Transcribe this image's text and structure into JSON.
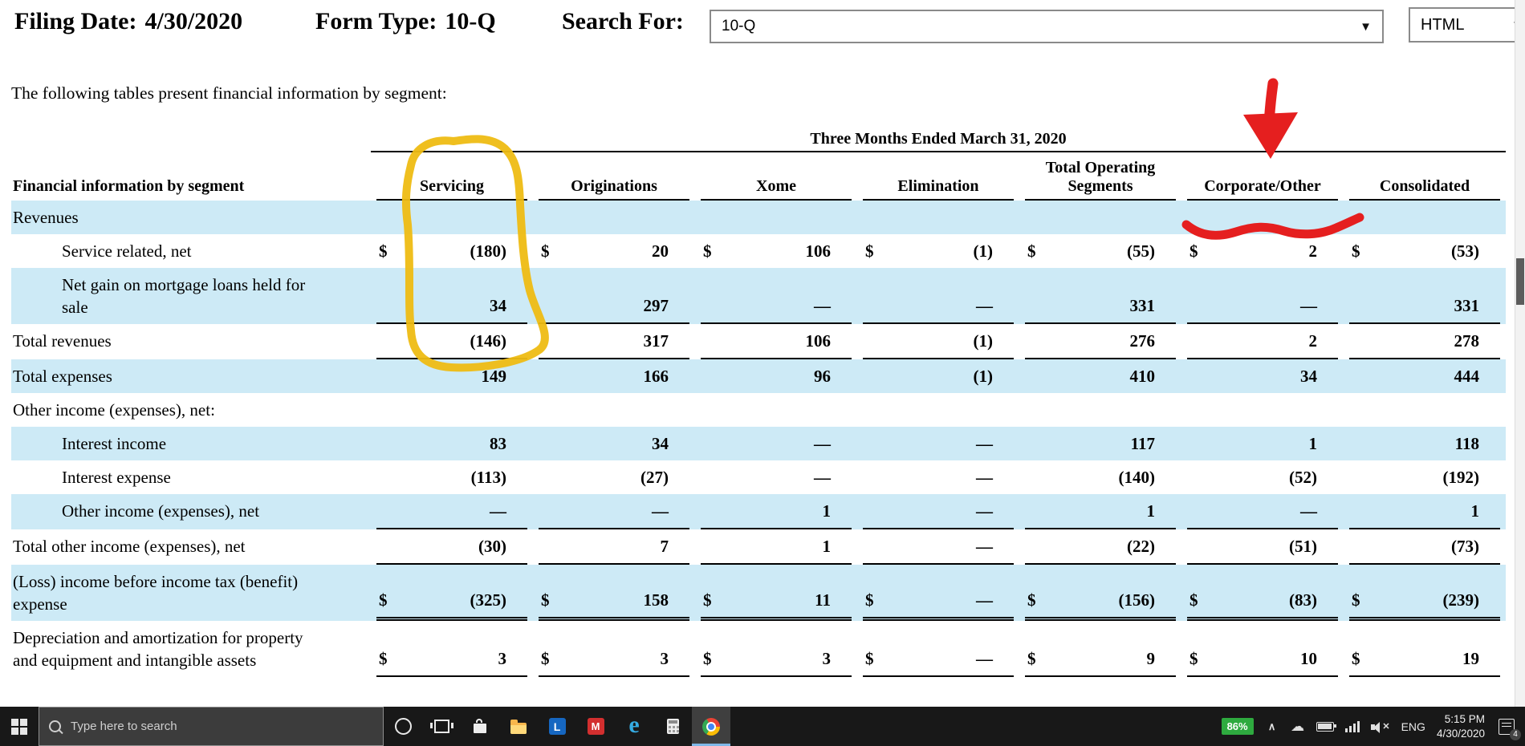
{
  "topbar": {
    "filing_date_label": "Filing Date:",
    "filing_date_value": "4/30/2020",
    "form_type_label": "Form Type:",
    "form_type_value": "10-Q",
    "search_label": "Search For:",
    "search_value": "10-Q",
    "format_value": "HTML",
    "dropdown_arrow": "▼"
  },
  "intro": "The following tables present financial information by segment:",
  "table": {
    "period_header": "Three Months Ended March 31, 2020",
    "label_header": "Financial information by segment",
    "currency_symbol": "$",
    "columns": [
      "Servicing",
      "Originations",
      "Xome",
      "Elimination",
      "Total Operating Segments",
      "Corporate/Other",
      "Consolidated"
    ],
    "rows": [
      {
        "label": "Revenues",
        "section": true,
        "shaded": true,
        "indent": false,
        "dollar": false,
        "underline": "none",
        "values": [
          "",
          "",
          "",
          "",
          "",
          "",
          ""
        ]
      },
      {
        "label": "Service related, net",
        "section": false,
        "shaded": false,
        "indent": true,
        "dollar": true,
        "underline": "none",
        "values": [
          "(180)",
          "20",
          "106",
          "(1)",
          "(55)",
          "2",
          "(53)"
        ]
      },
      {
        "label": "Net gain on mortgage loans held for sale",
        "section": false,
        "shaded": true,
        "indent": true,
        "dollar": false,
        "underline": "single",
        "values": [
          "34",
          "297",
          "—",
          "—",
          "331",
          "—",
          "331"
        ]
      },
      {
        "label": "Total revenues",
        "section": false,
        "shaded": false,
        "indent": false,
        "dollar": false,
        "underline": "single",
        "values": [
          "(146)",
          "317",
          "106",
          "(1)",
          "276",
          "2",
          "278"
        ]
      },
      {
        "label": "Total expenses",
        "section": false,
        "shaded": true,
        "indent": false,
        "dollar": false,
        "underline": "none",
        "values": [
          "149",
          "166",
          "96",
          "(1)",
          "410",
          "34",
          "444"
        ]
      },
      {
        "label": "Other income (expenses), net:",
        "section": true,
        "shaded": false,
        "indent": false,
        "dollar": false,
        "underline": "none",
        "values": [
          "",
          "",
          "",
          "",
          "",
          "",
          ""
        ]
      },
      {
        "label": "Interest income",
        "section": false,
        "shaded": true,
        "indent": true,
        "dollar": false,
        "underline": "none",
        "values": [
          "83",
          "34",
          "—",
          "—",
          "117",
          "1",
          "118"
        ]
      },
      {
        "label": "Interest expense",
        "section": false,
        "shaded": false,
        "indent": true,
        "dollar": false,
        "underline": "none",
        "values": [
          "(113)",
          "(27)",
          "—",
          "—",
          "(140)",
          "(52)",
          "(192)"
        ]
      },
      {
        "label": "Other income (expenses), net",
        "section": false,
        "shaded": true,
        "indent": true,
        "dollar": false,
        "underline": "single",
        "values": [
          "—",
          "—",
          "1",
          "—",
          "1",
          "—",
          "1"
        ]
      },
      {
        "label": "Total other income (expenses), net",
        "section": false,
        "shaded": false,
        "indent": false,
        "dollar": false,
        "underline": "single",
        "values": [
          "(30)",
          "7",
          "1",
          "—",
          "(22)",
          "(51)",
          "(73)"
        ]
      },
      {
        "label": "(Loss) income before income tax (benefit) expense",
        "section": false,
        "shaded": true,
        "indent": false,
        "dollar": true,
        "underline": "double",
        "values": [
          "(325)",
          "158",
          "11",
          "—",
          "(156)",
          "(83)",
          "(239)"
        ]
      },
      {
        "label": "Depreciation and amortization for property and equipment and intangible assets",
        "section": false,
        "shaded": false,
        "indent": false,
        "dollar": true,
        "underline": "single",
        "values": [
          "3",
          "3",
          "3",
          "—",
          "9",
          "10",
          "19"
        ]
      }
    ]
  },
  "annotations": {
    "highlight_color": "#eebc13",
    "arrow_color": "#e51f1f"
  },
  "colors": {
    "shaded_row": "#cdeaf6",
    "taskbar_bg": "#181818",
    "battery_badge": "#2eaa3f"
  },
  "taskbar": {
    "search_placeholder": "Type here to search",
    "l_letter": "L",
    "m_letter": "M",
    "edge_letter": "e",
    "battery_percent": "86%",
    "language": "ENG",
    "time": "5:15 PM",
    "date": "4/30/2020",
    "notification_count": "4"
  }
}
